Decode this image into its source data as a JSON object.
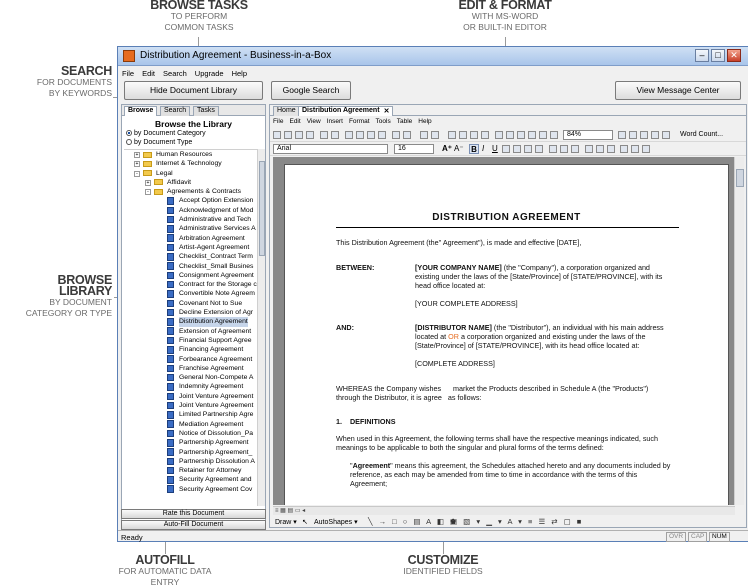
{
  "callouts": {
    "browse_tasks": {
      "title": "BROWSE TASKS",
      "line1": "TO PERFORM",
      "line2": "COMMON TASKS"
    },
    "search": {
      "title": "SEARCH",
      "line1": "FOR DOCUMENTS",
      "line2": "BY KEYWORDS"
    },
    "browse_library": {
      "title1": "BROWSE",
      "title2": "LIBRARY",
      "line1": "BY DOCUMENT",
      "line2": "CATEGORY OR TYPE"
    },
    "edit_format": {
      "title": "EDIT & FORMAT",
      "line1": "WITH MS-WORD",
      "line2": "OR BUILT-IN EDITOR"
    },
    "autofill": {
      "title": "AUTOFILL",
      "line1": "FOR AUTOMATIC DATA ENTRY"
    },
    "customize": {
      "title": "CUSTOMIZE",
      "line1": "IDENTIFIED FIELDS"
    }
  },
  "window": {
    "title": "Distribution Agreement - Business-in-a-Box",
    "menu": [
      "File",
      "Edit",
      "Search",
      "Upgrade",
      "Help"
    ],
    "buttons": {
      "hide_library": "Hide Document Library",
      "google_search": "Google Search",
      "message_center": "View Message Center"
    }
  },
  "library": {
    "tabs": [
      "Browse",
      "Search",
      "Tasks"
    ],
    "heading": "Browse the Library",
    "radio_category": "by Document Category",
    "radio_type": "by Document Type",
    "folders": [
      "Human Resources",
      "Internet & Technology",
      "Legal",
      "Affidavit",
      "Agreements & Contracts"
    ],
    "docs": [
      "Accept Option Extension",
      "Acknowledgment of Mod",
      "Administrative and Tech",
      "Administrative Services A",
      "Arbitration Agreement",
      "Artist-Agent Agreement",
      "Checklist_Contract Term",
      "Checklist_Small Busines",
      "Consignment Agreement",
      "Contract for the Storage c",
      "Convertible Note Agreem",
      "Covenant Not to Sue",
      "Decline Extension of Agr",
      "Distribution Agreement",
      "Extension of Agreement",
      "Financial Support Agree",
      "Financing Agreement",
      "Forbearance Agreement",
      "Franchise Agreement",
      "General Non-Compete A",
      "Indemnity Agreement",
      "Joint Venture Agreement",
      "Joint Venture Agreement",
      "Limited Partnership Agre",
      "Mediation Agreement",
      "Notice of Dissolution_Pa",
      "Partnership Agreement",
      "Partnership Agreement_",
      "Partnership Dissolution A",
      "Retainer for Attorney",
      "Security Agreement and",
      "Security Agreement Cov"
    ],
    "rate_button": "Rate this Document",
    "autofill_button": "Auto-Fill Document"
  },
  "editor": {
    "tabs": [
      "Home",
      "Distribution Agreement"
    ],
    "menu": [
      "File",
      "Edit",
      "View",
      "Insert",
      "Format",
      "Tools",
      "Table",
      "Help"
    ],
    "zoom": "84%",
    "word_count": "Word Count...",
    "font": "Arial",
    "size": "16",
    "draw": "Draw",
    "autoshapes": "AutoShapes"
  },
  "document": {
    "title": "DISTRIBUTION AGREEMENT",
    "intro": "This Distribution Agreement (the\" Agreement\"), is made and effective [DATE],",
    "between_label": "BETWEEN:",
    "company_bold": "[YOUR COMPANY NAME]",
    "company_text": " (the \"Company\"), a corporation organized and",
    "company_line2": "existing under the laws of the [State/Province] of [STATE/PROVINCE], with its",
    "company_line3": "head office located at:",
    "company_address": "[YOUR COMPLETE ADDRESS]",
    "and_label": "AND:",
    "distributor_bold": "[DISTRIBUTOR NAME]",
    "distributor_text": " (the \"Distributor\"), an individual with his main address",
    "distributor_line2a": "located at ",
    "distributor_or": "OR",
    "distributor_line2b": " a corporation organized and existing under the laws of the",
    "distributor_line3": "[State/Province] of [STATE/PROVINCE], with its head office located at:",
    "distributor_address": "[COMPLETE ADDRESS]",
    "whereas1": "WHEREAS the Company wishes      market the Products described in Schedule A (the \"Products\")",
    "whereas2": "through the Distributor, it is agree   as follows:",
    "section1": "1.    DEFINITIONS",
    "def1": "When used in this Agreement, the following terms shall have the respective meanings indicated, such",
    "def2": "meanings to be applicable to both the singular and plural forms of the terms defined:",
    "agreement_bold": "Agreement",
    "agr1": "\" means this agreement, the Schedules attached hereto and any documents included by",
    "agr2": "reference, as each may be amended from time to time in accordance with the terms of this",
    "agr3": "Agreement;"
  },
  "status": {
    "ready": "Ready",
    "ovr": "OVR",
    "cap": "CAP",
    "num": "NUM"
  },
  "colors": {
    "accent": "#e66b1f",
    "title_bar": "#a9c5ea",
    "selection": "#c6d5ea"
  }
}
